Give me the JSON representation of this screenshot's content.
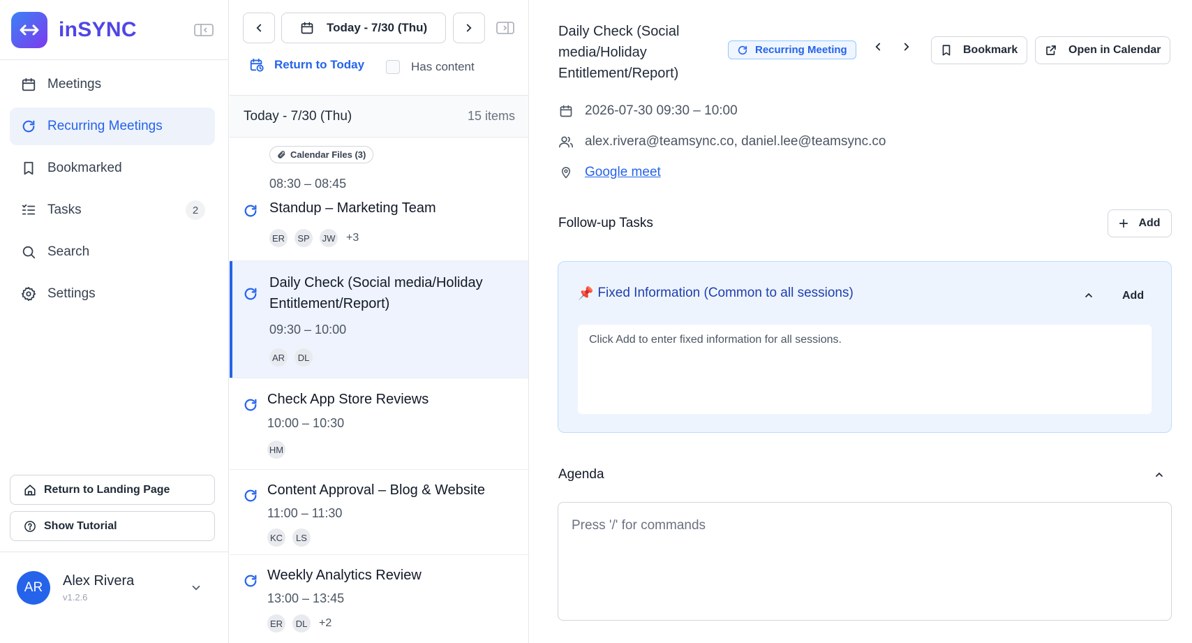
{
  "app": {
    "name": "inSYNC",
    "accent": "#2563eb"
  },
  "sidebar": {
    "items": [
      {
        "label": "Meetings",
        "icon": "calendar-icon"
      },
      {
        "label": "Recurring Meetings",
        "icon": "refresh-icon",
        "active": true
      },
      {
        "label": "Bookmarked",
        "icon": "bookmark-icon"
      },
      {
        "label": "Tasks",
        "icon": "tasks-icon",
        "badge": "2"
      },
      {
        "label": "Search",
        "icon": "search-icon"
      },
      {
        "label": "Settings",
        "icon": "gear-icon"
      }
    ],
    "return_landing": "Return to Landing Page",
    "show_tutorial": "Show Tutorial",
    "user": {
      "initials": "AR",
      "name": "Alex Rivera",
      "version": "v1.2.6"
    }
  },
  "list_panel": {
    "date_button": "Today - 7/30 (Thu)",
    "return_today": "Return to Today",
    "has_content": "Has content",
    "header_date": "Today - 7/30 (Thu)",
    "header_count": "15 items",
    "meetings": [
      {
        "chip": "Calendar Files (3)",
        "time": "08:30 – 08:45",
        "title": "Standup – Marketing Team",
        "avatars": [
          "ER",
          "SP",
          "JW"
        ],
        "more": "+3"
      },
      {
        "title_line1": "Daily Check (Social media/Holiday",
        "title_line2": "Entitlement/Report)",
        "time": "09:30 – 10:00",
        "avatars": [
          "AR",
          "DL"
        ],
        "active": true
      },
      {
        "title": "Check App Store Reviews",
        "time": "10:00 – 10:30",
        "avatars": [
          "HM"
        ]
      },
      {
        "title": "Content Approval – Blog & Website",
        "time": "11:00 – 11:30",
        "avatars": [
          "KC",
          "LS"
        ]
      },
      {
        "title": "Weekly Analytics Review",
        "time": "13:00 – 13:45",
        "avatars": [
          "ER",
          "DL"
        ],
        "more": "+2"
      }
    ]
  },
  "detail": {
    "title_line1": "Daily Check (Social",
    "title_line2": "media/Holiday",
    "title_line3": "Entitlement/Report)",
    "badge": "Recurring Meeting",
    "bookmark": "Bookmark",
    "open_calendar": "Open in Calendar",
    "datetime": "2026-07-30 09:30 – 10:00",
    "attendees": "alex.rivera@teamsync.co, daniel.lee@teamsync.co",
    "location": "Google meet",
    "followup_title": "Follow-up Tasks",
    "add": "Add",
    "fixed_title": "Fixed Information (Common to all sessions)",
    "fixed_add": "Add",
    "fixed_placeholder": "Click Add to enter fixed information for all sessions.",
    "agenda_title": "Agenda",
    "agenda_placeholder": "Press '/' for commands"
  }
}
